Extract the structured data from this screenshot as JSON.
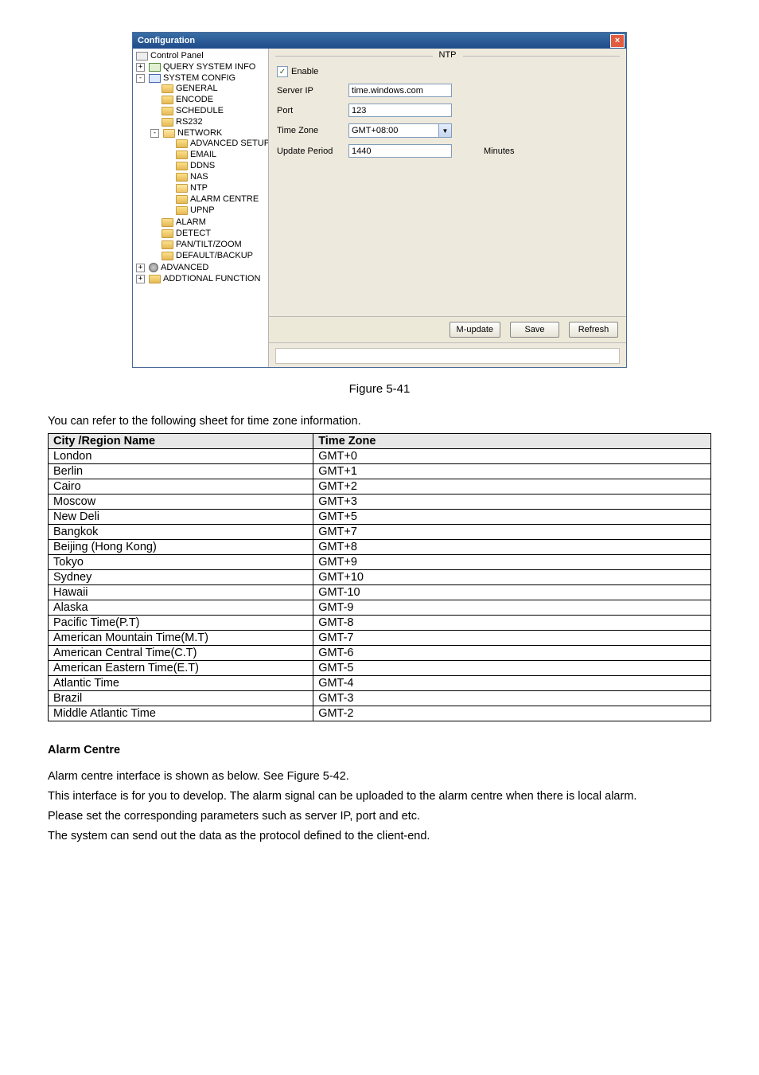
{
  "window": {
    "title": "Configuration",
    "close": "×"
  },
  "tree": {
    "rootLabel": "Control Panel",
    "query": "QUERY SYSTEM INFO",
    "sysconfig": "SYSTEM CONFIG",
    "items": {
      "general": "GENERAL",
      "encode": "ENCODE",
      "schedule": "SCHEDULE",
      "rs232": "RS232",
      "network": "NETWORK",
      "advsetup": "ADVANCED SETUP",
      "email": "EMAIL",
      "ddns": "DDNS",
      "nas": "NAS",
      "ntp": "NTP",
      "alarmcentre": "ALARM CENTRE",
      "upnp": "UPNP",
      "alarm": "ALARM",
      "detect": "DETECT",
      "ptz": "PAN/TILT/ZOOM",
      "defaultbackup": "DEFAULT/BACKUP"
    },
    "advanced": "ADVANCED",
    "addfunc": "ADDTIONAL FUNCTION"
  },
  "form": {
    "heading": "NTP",
    "enable": "Enable",
    "serverIpLabel": "Server IP",
    "serverIpValue": "time.windows.com",
    "portLabel": "Port",
    "portValue": "123",
    "tzLabel": "Time Zone",
    "tzValue": "GMT+08:00",
    "updLabel": "Update Period",
    "updValue": "1440",
    "updUnit": "Minutes"
  },
  "buttons": {
    "mupdate": "M-update",
    "save": "Save",
    "refresh": "Refresh"
  },
  "caption": "Figure 5-41",
  "introText": "You can refer to the following sheet for time zone information.",
  "tableHeaders": {
    "city": "City /Region Name",
    "tz": "Time Zone"
  },
  "tzRows": [
    {
      "city": "London",
      "tz": "GMT+0"
    },
    {
      "city": "Berlin",
      "tz": "GMT+1"
    },
    {
      "city": "Cairo",
      "tz": "GMT+2"
    },
    {
      "city": "Moscow",
      "tz": "GMT+3"
    },
    {
      "city": "New Deli",
      "tz": "GMT+5"
    },
    {
      "city": "Bangkok",
      "tz": "GMT+7"
    },
    {
      "city": "Beijing (Hong Kong)",
      "tz": "GMT+8"
    },
    {
      "city": "Tokyo",
      "tz": "GMT+9"
    },
    {
      "city": "Sydney",
      "tz": "GMT+10"
    },
    {
      "city": "Hawaii",
      "tz": "GMT-10"
    },
    {
      "city": "Alaska",
      "tz": "GMT-9"
    },
    {
      "city": "Pacific Time(P.T)",
      "tz": "GMT-8"
    },
    {
      "city": "American  Mountain Time(M.T)",
      "tz": "GMT-7"
    },
    {
      "city": "American Central Time(C.T)",
      "tz": "GMT-6"
    },
    {
      "city": "American Eastern Time(E.T)",
      "tz": "GMT-5"
    },
    {
      "city": "Atlantic Time",
      "tz": "GMT-4"
    },
    {
      "city": "Brazil",
      "tz": "GMT-3"
    },
    {
      "city": "Middle Atlantic Time",
      "tz": "GMT-2"
    }
  ],
  "section": {
    "heading": "Alarm Centre",
    "p1": "Alarm centre interface is shown as below. See Figure 5-42.",
    "p2": "This interface is for you to develop. The alarm signal can be uploaded to the alarm centre when there is local alarm.",
    "p3": "Please set the corresponding parameters such as server IP, port and etc.",
    "p4": "The system can send out the data as the protocol defined to the client-end."
  }
}
